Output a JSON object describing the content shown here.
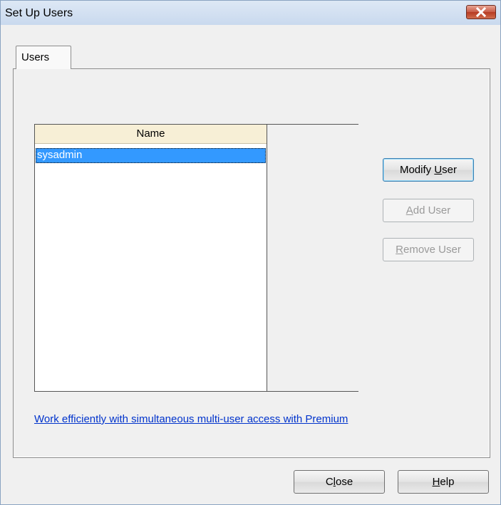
{
  "window": {
    "title": "Set Up Users"
  },
  "tabs": [
    {
      "label": "Users"
    }
  ],
  "users_list": {
    "column_header": "Name",
    "rows": [
      {
        "name": "sysadmin",
        "selected": true
      }
    ]
  },
  "buttons": {
    "modify_user": {
      "label": "Modify User",
      "accel_before": "Modify ",
      "accel": "U",
      "accel_after": "ser",
      "enabled": true
    },
    "add_user": {
      "label": "Add User",
      "accel_before": "",
      "accel": "A",
      "accel_after": "dd User",
      "enabled": false
    },
    "remove_user": {
      "label": "Remove User",
      "accel_before": "",
      "accel": "R",
      "accel_after": "emove User",
      "enabled": false
    },
    "close": {
      "label": "Close",
      "accel_before": "C",
      "accel": "l",
      "accel_after": "ose"
    },
    "help": {
      "label": "Help",
      "accel_before": "",
      "accel": "H",
      "accel_after": "elp"
    }
  },
  "premium_link": "Work efficiently with simultaneous multi-user access with Premium",
  "colors": {
    "selection": "#3399ff",
    "link": "#0033cc",
    "header_bg": "#f7efd6"
  },
  "icons": {
    "close": "close-x-icon"
  }
}
